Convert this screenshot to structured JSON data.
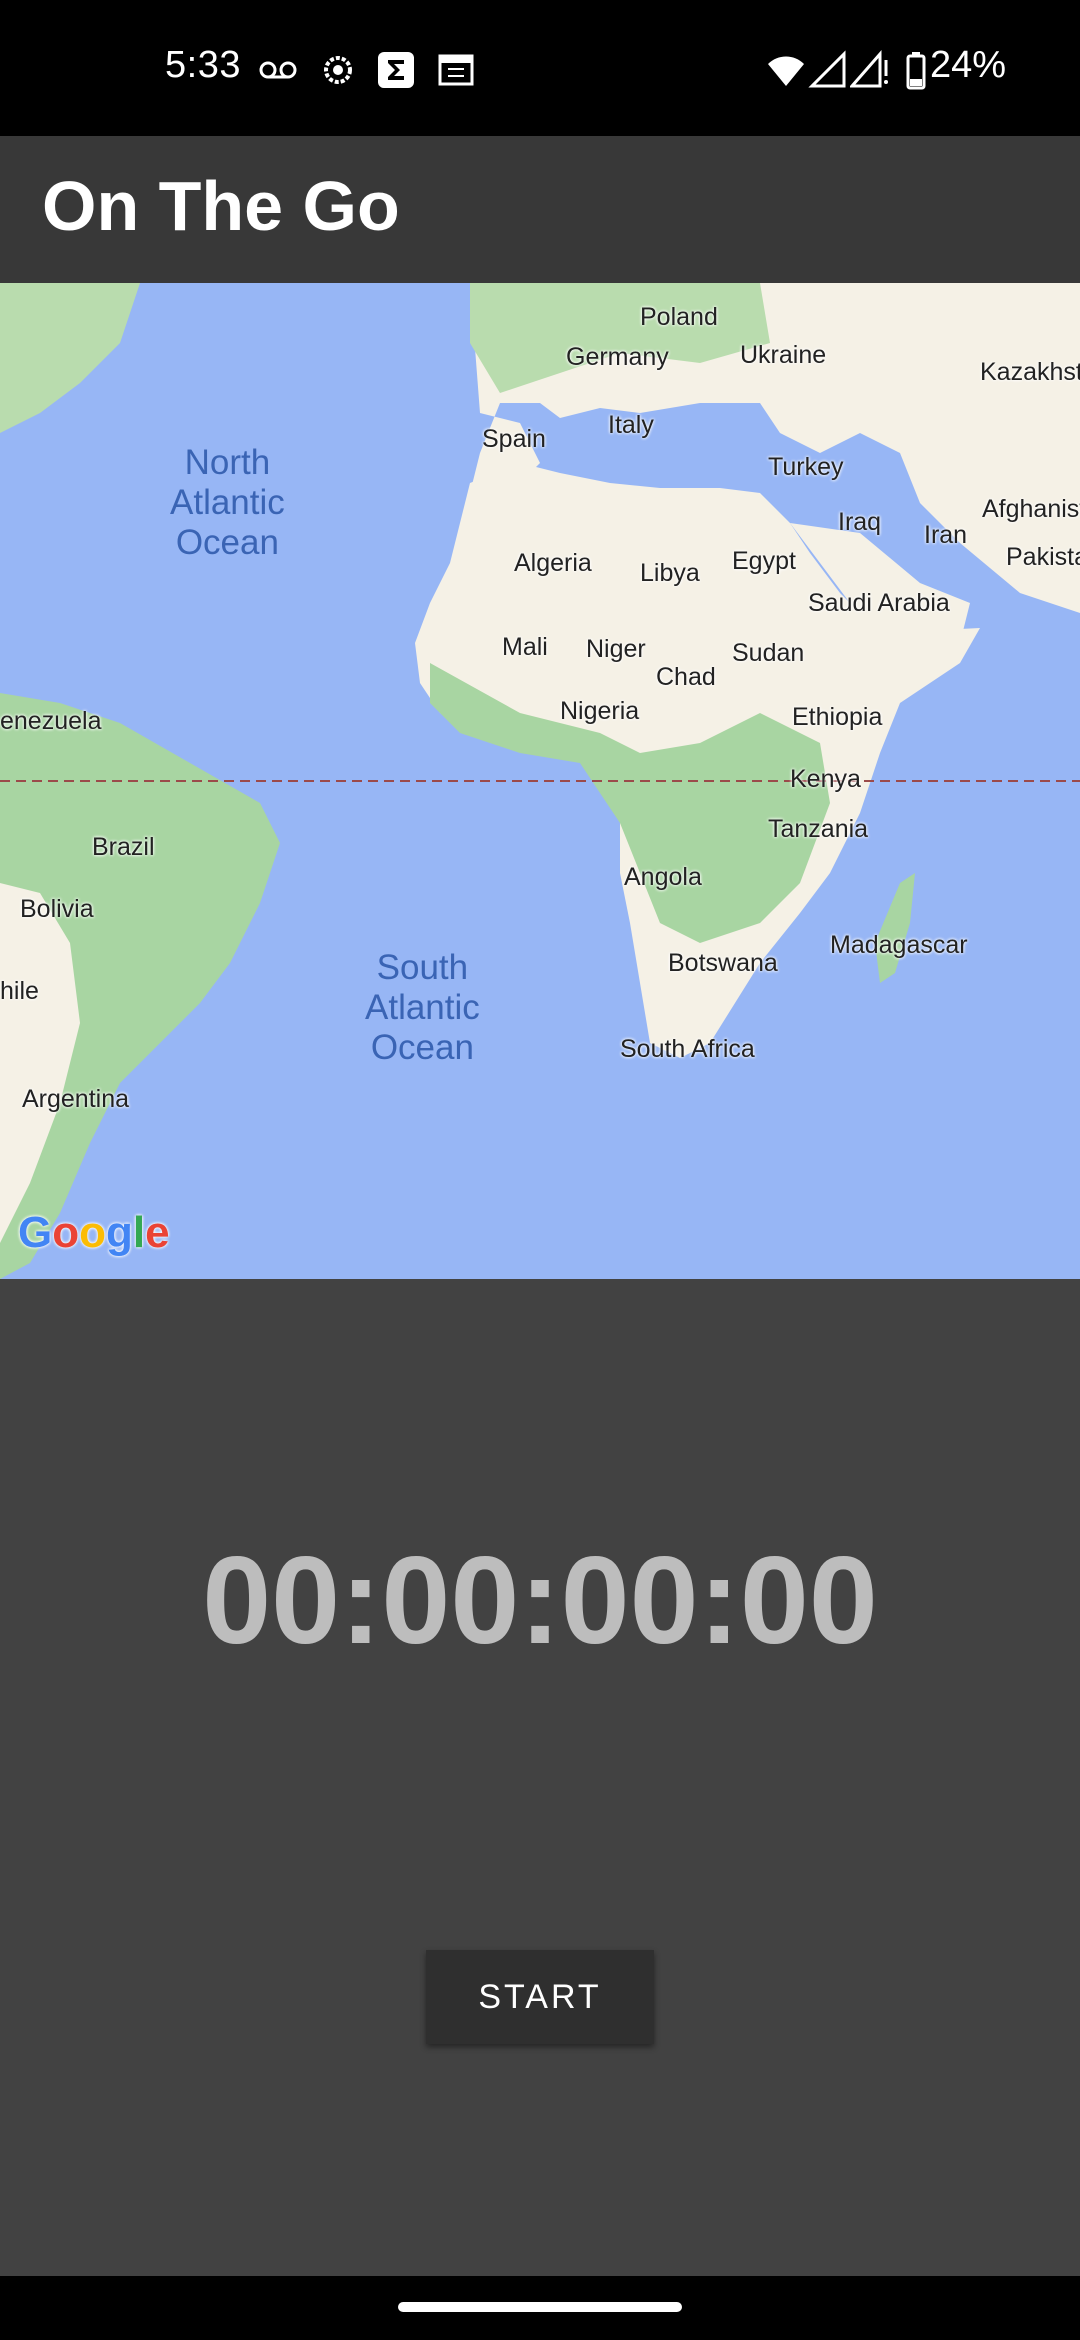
{
  "status_bar": {
    "time": "5:33",
    "battery": "24%",
    "icons": [
      "voicemail-icon",
      "settings-icon",
      "sigma-icon",
      "calendar-icon",
      "wifi-icon",
      "signal-icon",
      "signal-alert-icon",
      "battery-icon"
    ]
  },
  "app": {
    "title": "On The Go"
  },
  "map": {
    "provider_logo": "Google",
    "oceans": {
      "north_atlantic": "North Atlantic Ocean",
      "south_atlantic": "South Atlantic Ocean"
    },
    "labels": {
      "poland": "Poland",
      "germany": "Germany",
      "ukraine": "Ukraine",
      "kazakhstan": "Kazakhsta",
      "spain": "Spain",
      "italy": "Italy",
      "turkey": "Turkey",
      "afghanistan": "Afghanist",
      "iraq": "Iraq",
      "iran": "Iran",
      "pakistan": "Pakista",
      "algeria": "Algeria",
      "libya": "Libya",
      "egypt": "Egypt",
      "saudi_arabia": "Saudi Arabia",
      "mali": "Mali",
      "niger": "Niger",
      "sudan": "Sudan",
      "chad": "Chad",
      "venezuela": "enezuela",
      "nigeria": "Nigeria",
      "ethiopia": "Ethiopia",
      "kenya": "Kenya",
      "brazil": "Brazil",
      "tanzania": "Tanzania",
      "angola": "Angola",
      "bolivia": "Bolivia",
      "madagascar": "Madagascar",
      "botswana": "Botswana",
      "chile": "hile",
      "south_africa": "South Africa",
      "argentina": "Argentina"
    },
    "colors": {
      "water": "#97b6f5",
      "land": "#f5f1e6",
      "vegetation": "#a8d5a2",
      "equator": "#9b4a4a"
    }
  },
  "timer": {
    "value": "00:00:00:00"
  },
  "controls": {
    "start_label": "START"
  }
}
